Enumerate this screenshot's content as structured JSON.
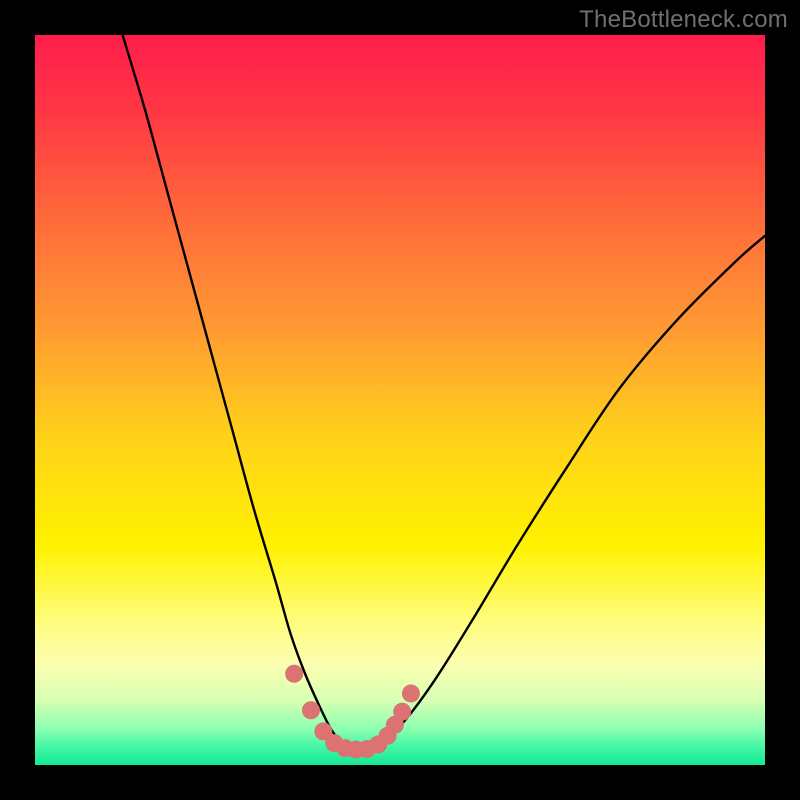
{
  "attribution": "TheBottleneck.com",
  "colors": {
    "frame": "#000000",
    "curve": "#000000",
    "dots": "#dd7272",
    "gradient_stops": [
      {
        "offset": 0.0,
        "color": "#ff1d4b"
      },
      {
        "offset": 0.1,
        "color": "#ff3545"
      },
      {
        "offset": 0.25,
        "color": "#ff6a3a"
      },
      {
        "offset": 0.4,
        "color": "#ff9933"
      },
      {
        "offset": 0.55,
        "color": "#ffd21a"
      },
      {
        "offset": 0.7,
        "color": "#fff200"
      },
      {
        "offset": 0.8,
        "color": "#fffc7a"
      },
      {
        "offset": 0.86,
        "color": "#fcffb0"
      },
      {
        "offset": 0.91,
        "color": "#d9ffb4"
      },
      {
        "offset": 0.95,
        "color": "#8dffb0"
      },
      {
        "offset": 0.975,
        "color": "#44f7a8"
      },
      {
        "offset": 1.0,
        "color": "#15e793"
      }
    ]
  },
  "chart_data": {
    "type": "line",
    "title": "",
    "xlabel": "",
    "ylabel": "",
    "xlim": [
      0,
      100
    ],
    "ylim": [
      0,
      100
    ],
    "series": [
      {
        "name": "bottleneck-curve",
        "x": [
          12,
          15,
          18,
          21,
          24,
          27,
          30,
          33,
          35,
          37,
          39,
          40.5,
          42,
          43.5,
          45,
          48,
          51,
          55,
          60,
          66,
          73,
          80,
          88,
          96,
          100
        ],
        "y": [
          100,
          90,
          79,
          68,
          57,
          46,
          35,
          25,
          18,
          12.5,
          8,
          5,
          3,
          2,
          2,
          3.5,
          6.5,
          12,
          20,
          30,
          41,
          51.5,
          61,
          69,
          72.5
        ]
      }
    ],
    "highlight_points": {
      "name": "valley-dots",
      "x": [
        35.5,
        37.8,
        39.5,
        41,
        42.5,
        44,
        45.5,
        47,
        48.3,
        49.3,
        50.3,
        51.5
      ],
      "y": [
        12.5,
        7.5,
        4.6,
        3.0,
        2.3,
        2.1,
        2.2,
        2.8,
        4.0,
        5.5,
        7.3,
        9.8
      ]
    }
  }
}
